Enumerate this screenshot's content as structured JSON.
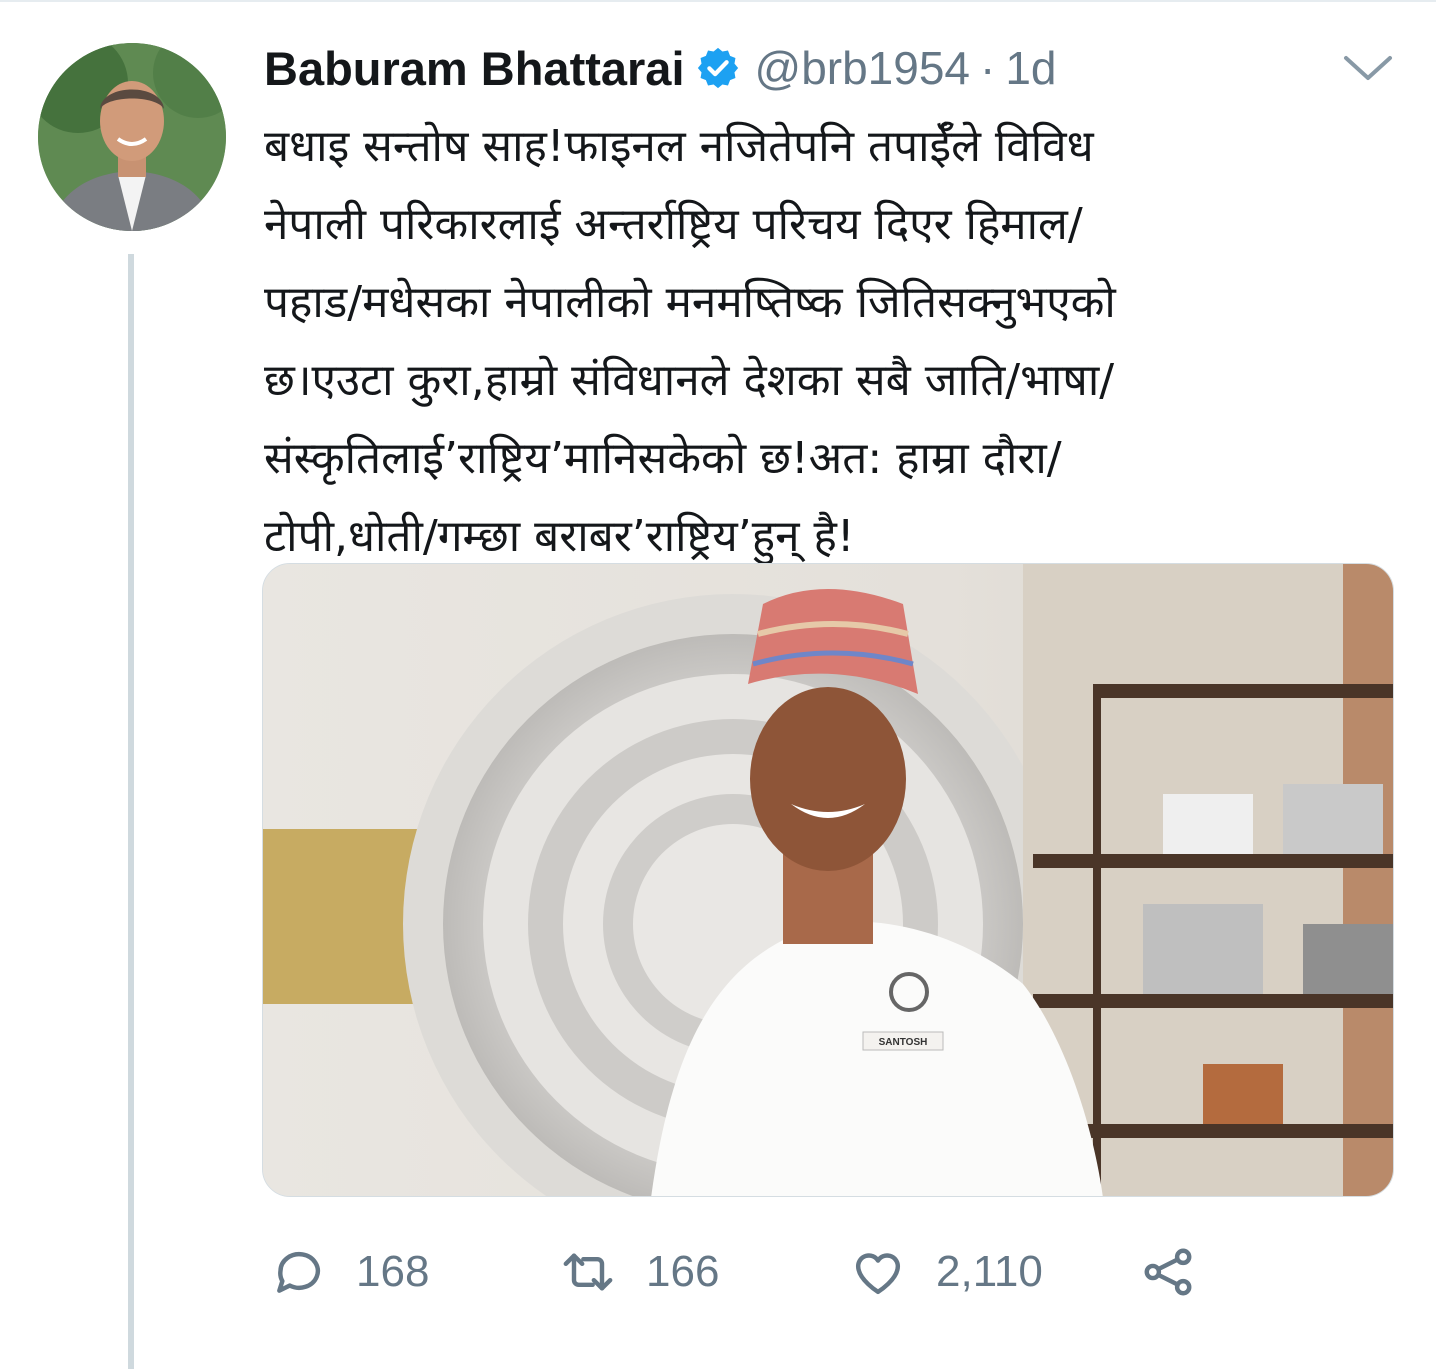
{
  "tweet": {
    "display_name": "Baburam Bhattarai",
    "handle": "@brb1954",
    "separator": "·",
    "time": "1d",
    "text_lines": [
      "बधाइ सन्तोष साह!फाइनल नजितेपनि तपाईँले विविध",
      "नेपाली परिकारलाई अन्तर्राष्ट्रिय परिचय दिएर हिमाल/",
      "पहाड/मधेसका नेपालीको मनमष्तिष्क जितिसक्नुभएको",
      "छ।एउटा कुरा,हाम्रो संविधानले देशका सबै जाति/भाषा/",
      "संस्कृतिलाई’राष्ट्रिय’मानिसकेको छ!अत: हाम्रा दौरा/",
      "टोपी,धोती/गम्छा बराबर’राष्ट्रिय’हुन् है!"
    ],
    "media": {
      "badge_text": "SANTOSH"
    }
  },
  "actions": {
    "reply_count": "168",
    "retweet_count": "166",
    "like_count": "2,110"
  },
  "colors": {
    "text": "#14171a",
    "secondary": "#657786",
    "verified": "#1da1f2",
    "thread_line": "#cfd9de"
  },
  "icons": [
    "verified-badge-icon",
    "chevron-down-icon",
    "reply-icon",
    "retweet-icon",
    "like-icon",
    "share-icon"
  ]
}
